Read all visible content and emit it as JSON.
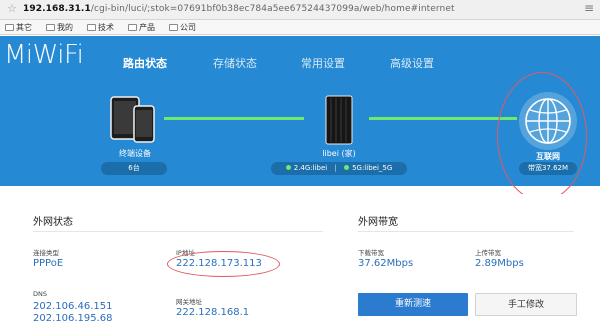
{
  "browser": {
    "url_host": "192.168.31.1",
    "url_path": "/cgi-bin/luci/;stok=07691bf0b38ec784a5ee67524437099a/web/home#internet",
    "bookmarks": [
      "其它",
      "我的",
      "技术",
      "产品",
      "公司"
    ]
  },
  "app": {
    "logo": "MiWiFi",
    "nav": [
      "路由状态",
      "存储状态",
      "常用设置",
      "高级设置"
    ]
  },
  "topology": {
    "devices_label": "终端设备",
    "devices_count": "6台",
    "router_label": "libei (家)",
    "wifi_24": "2.4G:libei",
    "wifi_5": "5G:libei_5G",
    "internet_label": "互联网",
    "internet_bandwidth": "带宽37.62M"
  },
  "wan_status": {
    "title": "外网状态",
    "conn_type_label": "连接类型",
    "conn_type": "PPPoE",
    "ip_label": "IP地址",
    "ip": "222.128.173.113",
    "dns_label": "DNS",
    "dns1": "202.106.46.151",
    "dns2": "202.106.195.68",
    "gateway_label": "网关地址",
    "gateway": "222.128.168.1"
  },
  "wan_bandwidth": {
    "title": "外网带宽",
    "down_label": "下载带宽",
    "down": "37.62Mbps",
    "up_label": "上传带宽",
    "up": "2.89Mbps",
    "retest_button": "重新测速",
    "manual_button": "手工修改"
  },
  "colors": {
    "header_blue": "#2589d3",
    "link_green": "#6ee96e",
    "value_blue": "#2a6fbd",
    "annotation_red": "#e05a63"
  }
}
